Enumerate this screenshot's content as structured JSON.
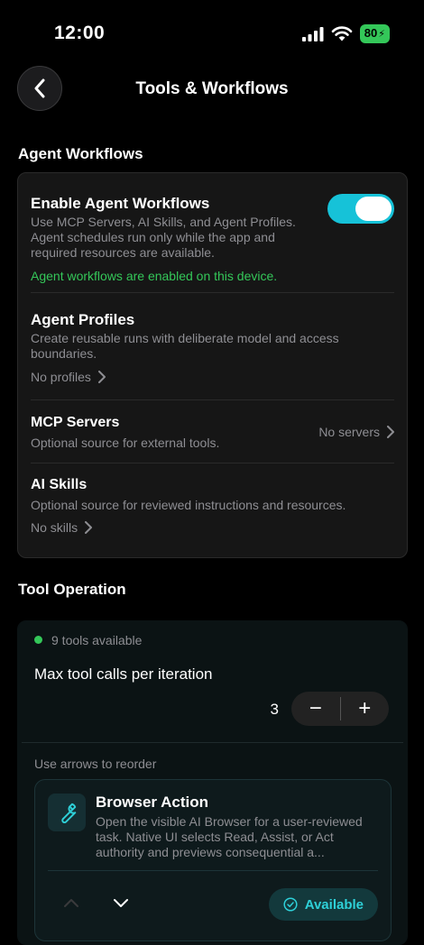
{
  "status_bar": {
    "time": "12:00",
    "battery": "80"
  },
  "header": {
    "title": "Tools & Workflows"
  },
  "agent_workflows": {
    "section_title": "Agent Workflows",
    "enable": {
      "title": "Enable Agent Workflows",
      "description": "Use MCP Servers, AI Skills, and Agent Profiles. Agent schedules run only while the app and required resources are available.",
      "status": "Agent workflows are enabled on this device.",
      "enabled": true
    },
    "profiles": {
      "title": "Agent Profiles",
      "description": "Create reusable runs with deliberate model and access boundaries.",
      "value": "No profiles"
    },
    "mcp": {
      "title": "MCP Servers",
      "description": "Optional source for external tools.",
      "value": "No servers"
    },
    "skills": {
      "title": "AI Skills",
      "description": "Optional source for reviewed instructions and resources.",
      "value": "No skills"
    }
  },
  "tool_operation": {
    "section_title": "Tool Operation",
    "tools_available": "9 tools available",
    "max_calls_label": "Max tool calls per iteration",
    "max_calls_value": "3",
    "minus": "−",
    "plus": "+",
    "reorder_hint": "Use arrows to reorder",
    "tool": {
      "name": "Browser Action",
      "description": "Open the visible AI Browser for a user-reviewed task. Native UI selects Read, Assist, or Act authority and previews consequential a...",
      "status": "Available"
    }
  },
  "colors": {
    "accent": "#16c2d8",
    "success": "#34c759",
    "available": "#2ed0d8"
  }
}
